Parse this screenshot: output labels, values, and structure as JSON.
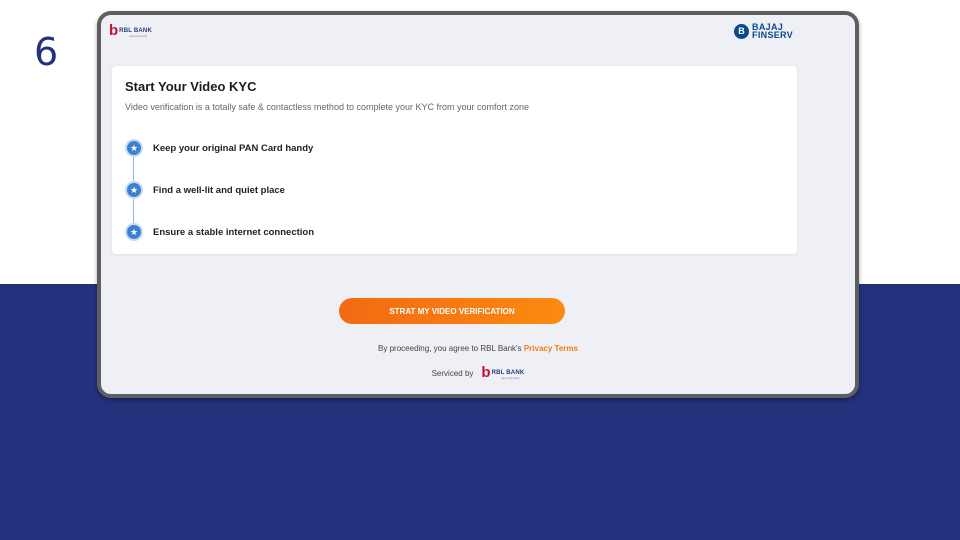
{
  "slide": {
    "step_number": "6"
  },
  "header": {
    "partner_logo": {
      "mark": "b",
      "name": "RBL BANK",
      "tagline": "apno ka bank"
    },
    "bajaj_logo": {
      "line1": "BAJAJ",
      "line2": "FINSERV",
      "icon_glyph": "B"
    }
  },
  "kyc_card": {
    "title": "Start Your Video KYC",
    "subtitle": "Video verification is a totally safe & contactless method to complete your KYC from your comfort zone",
    "steps": [
      {
        "label": "Keep your original PAN Card handy",
        "icon": "star-icon"
      },
      {
        "label": "Find a well-lit and quiet place",
        "icon": "star-icon"
      },
      {
        "label": "Ensure a stable internet connection",
        "icon": "star-icon"
      }
    ]
  },
  "cta": {
    "label": "STRAT MY VIDEO VERIFICATION"
  },
  "consent": {
    "prefix": "By proceeding, you agree to RBL Bank's",
    "link_text": "Privacy Terms"
  },
  "footer": {
    "serviced_by": "Serviced by",
    "logo_name": "RBL BANK",
    "logo_tagline": "apno ka bank"
  },
  "colors": {
    "brand_blue": "#24317c",
    "cta_orange": "#f26a12",
    "link_orange": "#f07b17",
    "rbl_red": "#c4122f",
    "bajaj_blue": "#0a4a8c"
  }
}
